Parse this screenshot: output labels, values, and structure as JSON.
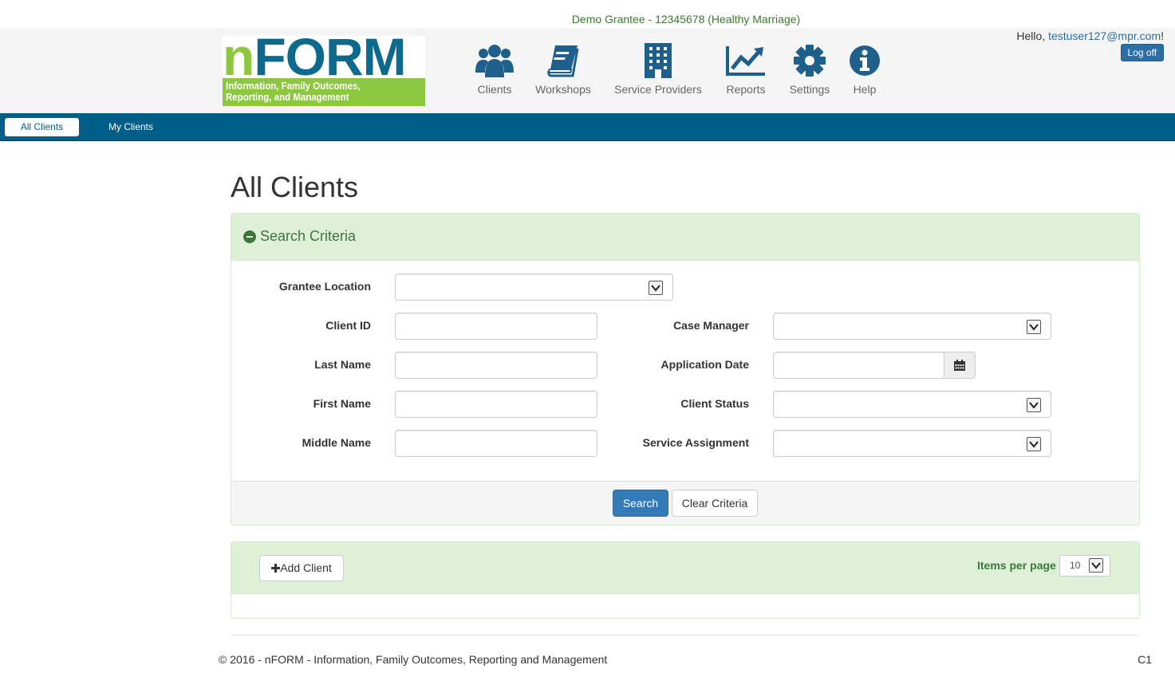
{
  "grantee_banner": "Demo Grantee - 12345678 (Healthy Marriage)",
  "logo": {
    "word_prefix": "n",
    "word_main": "FORM",
    "subtitle": "Information, Family Outcomes, Reporting, and Management"
  },
  "nav": {
    "clients": "Clients",
    "workshops": "Workshops",
    "service_providers": "Service Providers",
    "reports": "Reports",
    "settings": "Settings",
    "help": "Help"
  },
  "user": {
    "greeting": "Hello,",
    "email": "testuser127@mpr.com",
    "exclaim": "!",
    "logoff": "Log off"
  },
  "subnav": {
    "all_clients": "All Clients",
    "my_clients": "My Clients"
  },
  "page_title": "All Clients",
  "search": {
    "heading": "Search Criteria",
    "grantee_location": {
      "label": "Grantee Location",
      "value": ""
    },
    "client_id": {
      "label": "Client ID",
      "value": ""
    },
    "last_name": {
      "label": "Last Name",
      "value": ""
    },
    "first_name": {
      "label": "First Name",
      "value": ""
    },
    "middle_name": {
      "label": "Middle Name",
      "value": ""
    },
    "case_manager": {
      "label": "Case Manager",
      "value": ""
    },
    "application_date": {
      "label": "Application Date",
      "value": ""
    },
    "client_status": {
      "label": "Client Status",
      "value": ""
    },
    "service_assignment": {
      "label": "Service Assignment",
      "value": ""
    },
    "search_button": "Search",
    "clear_button": "Clear Criteria"
  },
  "list": {
    "add_client": "Add Client",
    "items_per_page_label": "Items per page",
    "items_per_page_value": "10"
  },
  "footer": {
    "copyright": "© 2016 - nFORM - Information, Family Outcomes, Reporting and Management",
    "code": "C1"
  },
  "colors": {
    "nav_blue": "#005e89",
    "icon_blue": "#1f5f8b",
    "panel_green": "#dff0d8",
    "logo_green": "#8dc63f",
    "primary_button": "#337ab7"
  },
  "icons": {
    "clients": "users-icon",
    "workshops": "book-icon",
    "service_providers": "building-icon",
    "reports": "line-chart-icon",
    "settings": "gear-icon",
    "help": "info-icon",
    "search_heading": "minus-circle-icon",
    "date": "calendar-icon",
    "add": "plus-icon"
  }
}
